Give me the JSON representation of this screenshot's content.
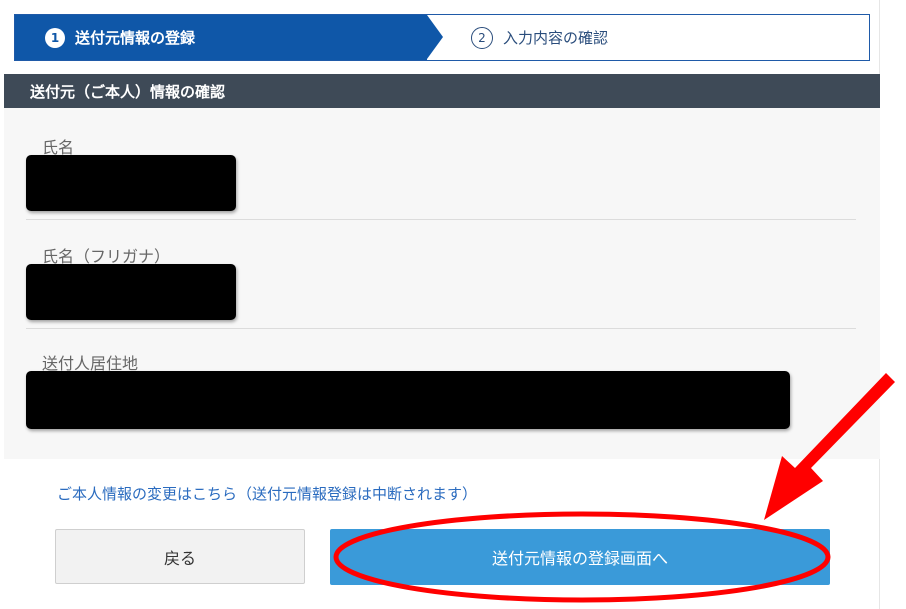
{
  "stepper": {
    "steps": [
      {
        "number": "1",
        "label": "送付元情報の登録",
        "state": "active"
      },
      {
        "number": "2",
        "label": "入力内容の確認",
        "state": "upcoming"
      }
    ]
  },
  "section": {
    "title": "送付元（ご本人）情報の確認"
  },
  "fields": [
    {
      "label": "氏名",
      "value_redacted": true
    },
    {
      "label": "氏名（フリガナ）",
      "value_redacted": true
    },
    {
      "label": "送付人居住地",
      "value_redacted": true
    }
  ],
  "links": {
    "change_info": "ご本人情報の変更はこちら（送付元情報登録は中断されます）"
  },
  "buttons": {
    "back": "戻る",
    "primary": "送付元情報の登録画面へ"
  },
  "colors": {
    "stepper_active": "#0f57a8",
    "section_header": "#3e4a57",
    "primary_button": "#3a9ad9",
    "link": "#2a6bbf",
    "annotation": "#ff0000"
  }
}
